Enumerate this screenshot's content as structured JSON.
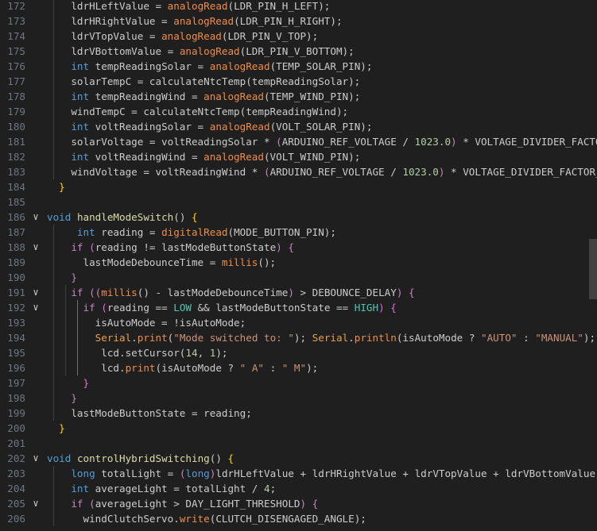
{
  "editor": {
    "lines": [
      {
        "num": "172",
        "fold": "",
        "tokens": [
          [
            "t-var",
            "    ldrHLeftValue = "
          ],
          [
            "t-ard",
            "analogRead"
          ],
          [
            "t-var",
            "(LDR_PIN_H_LEFT);"
          ]
        ]
      },
      {
        "num": "173",
        "fold": "",
        "tokens": [
          [
            "t-var",
            "    ldrHRightValue = "
          ],
          [
            "t-ard",
            "analogRead"
          ],
          [
            "t-var",
            "(LDR_PIN_H_RIGHT);"
          ]
        ]
      },
      {
        "num": "174",
        "fold": "",
        "tokens": [
          [
            "t-var",
            "    ldrVTopValue = "
          ],
          [
            "t-ard",
            "analogRead"
          ],
          [
            "t-var",
            "(LDR_PIN_V_TOP);"
          ]
        ]
      },
      {
        "num": "175",
        "fold": "",
        "tokens": [
          [
            "t-var",
            "    ldrVBottomValue = "
          ],
          [
            "t-ard",
            "analogRead"
          ],
          [
            "t-var",
            "(LDR_PIN_V_BOTTOM);"
          ]
        ]
      },
      {
        "num": "176",
        "fold": "",
        "tokens": [
          [
            "t-kw",
            "    int"
          ],
          [
            "t-var",
            " tempReadingSolar = "
          ],
          [
            "t-ard",
            "analogRead"
          ],
          [
            "t-var",
            "(TEMP_SOLAR_PIN);"
          ]
        ]
      },
      {
        "num": "177",
        "fold": "",
        "tokens": [
          [
            "t-var",
            "    solarTempC = calculateNtcTemp(tempReadingSolar);"
          ]
        ]
      },
      {
        "num": "178",
        "fold": "",
        "tokens": [
          [
            "t-kw",
            "    int"
          ],
          [
            "t-var",
            " tempReadingWind = "
          ],
          [
            "t-ard",
            "analogRead"
          ],
          [
            "t-var",
            "(TEMP_WIND_PIN);"
          ]
        ]
      },
      {
        "num": "179",
        "fold": "",
        "tokens": [
          [
            "t-var",
            "    windTempC = calculateNtcTemp(tempReadingWind);"
          ]
        ]
      },
      {
        "num": "180",
        "fold": "",
        "tokens": [
          [
            "t-kw",
            "    int"
          ],
          [
            "t-var",
            " voltReadingSolar = "
          ],
          [
            "t-ard",
            "analogRead"
          ],
          [
            "t-var",
            "(VOLT_SOLAR_PIN);"
          ]
        ]
      },
      {
        "num": "181",
        "fold": "",
        "tokens": [
          [
            "t-var",
            "    solarVoltage = voltReadingSolar * "
          ],
          [
            "t-paren1",
            "("
          ],
          [
            "t-var",
            "ARDUINO_REF_VOLTAGE / "
          ],
          [
            "t-num",
            "1023.0"
          ],
          [
            "t-paren1",
            ")"
          ],
          [
            "t-var",
            " * VOLTAGE_DIVIDER_FACTO"
          ]
        ]
      },
      {
        "num": "182",
        "fold": "",
        "tokens": [
          [
            "t-kw",
            "    int"
          ],
          [
            "t-var",
            " voltReadingWind = "
          ],
          [
            "t-ard",
            "analogRead"
          ],
          [
            "t-var",
            "(VOLT_WIND_PIN);"
          ]
        ]
      },
      {
        "num": "183",
        "fold": "",
        "tokens": [
          [
            "t-var",
            "    windVoltage = voltReadingWind * "
          ],
          [
            "t-paren1",
            "("
          ],
          [
            "t-var",
            "ARDUINO_REF_VOLTAGE / "
          ],
          [
            "t-num",
            "1023.0"
          ],
          [
            "t-paren1",
            ")"
          ],
          [
            "t-var",
            " * VOLTAGE_DIVIDER_FACTOR_"
          ]
        ]
      },
      {
        "num": "184",
        "fold": "",
        "tokens": [
          [
            "t-brace",
            "  }"
          ]
        ]
      },
      {
        "num": "185",
        "fold": "",
        "tokens": []
      },
      {
        "num": "186",
        "fold": "v",
        "tokens": [
          [
            "t-kw",
            "void"
          ],
          [
            "t-var",
            " "
          ],
          [
            "t-fn",
            "handleModeSwitch"
          ],
          [
            "t-var",
            "() "
          ],
          [
            "t-brace",
            "{"
          ]
        ]
      },
      {
        "num": "187",
        "fold": "",
        "tokens": [
          [
            "t-kw",
            "     int"
          ],
          [
            "t-var",
            " reading = "
          ],
          [
            "t-ard",
            "digitalRead"
          ],
          [
            "t-var",
            "(MODE_BUTTON_PIN);"
          ]
        ]
      },
      {
        "num": "188",
        "fold": "v",
        "tokens": [
          [
            "t-ctl",
            "    if"
          ],
          [
            "t-var",
            " "
          ],
          [
            "t-paren1",
            "("
          ],
          [
            "t-var",
            "reading != lastModeButtonState"
          ],
          [
            "t-paren1",
            ")"
          ],
          [
            "t-var",
            " "
          ],
          [
            "t-paren1",
            "{"
          ]
        ]
      },
      {
        "num": "189",
        "fold": "",
        "tokens": [
          [
            "t-var",
            "      lastModeDebounceTime = "
          ],
          [
            "t-ard",
            "millis"
          ],
          [
            "t-var",
            "();"
          ]
        ]
      },
      {
        "num": "190",
        "fold": "",
        "tokens": [
          [
            "t-paren1",
            "    }"
          ]
        ]
      },
      {
        "num": "191",
        "fold": "v",
        "tokens": [
          [
            "t-ctl",
            "    if"
          ],
          [
            "t-var",
            " "
          ],
          [
            "t-paren1",
            "(("
          ],
          [
            "t-ard",
            "millis"
          ],
          [
            "t-var",
            "() - lastModeDebounceTime"
          ],
          [
            "t-paren1",
            ")"
          ],
          [
            "t-var",
            " > DEBOUNCE_DELAY"
          ],
          [
            "t-paren1",
            ")"
          ],
          [
            "t-var",
            " "
          ],
          [
            "t-paren1",
            "{"
          ]
        ]
      },
      {
        "num": "192",
        "fold": "v",
        "tokens": [
          [
            "t-ctl",
            "      if"
          ],
          [
            "t-var",
            " "
          ],
          [
            "t-paren2",
            "("
          ],
          [
            "t-var",
            "reading == "
          ],
          [
            "t-lowhigh",
            "LOW"
          ],
          [
            "t-var",
            " && lastModeButtonState == "
          ],
          [
            "t-lowhigh",
            "HIGH"
          ],
          [
            "t-paren2",
            ")"
          ],
          [
            "t-var",
            " "
          ],
          [
            "t-paren2",
            "{"
          ]
        ]
      },
      {
        "num": "193",
        "fold": "",
        "tokens": [
          [
            "t-var",
            "        isAutoMode = !isAutoMode;"
          ]
        ]
      },
      {
        "num": "194",
        "fold": "",
        "tokens": [
          [
            "t-api",
            "        Serial"
          ],
          [
            "t-var",
            "."
          ],
          [
            "t-ard",
            "print"
          ],
          [
            "t-var",
            "("
          ],
          [
            "t-str",
            "\"Mode switched to: \""
          ],
          [
            "t-var",
            "); "
          ],
          [
            "t-api",
            "Serial"
          ],
          [
            "t-var",
            "."
          ],
          [
            "t-ard",
            "println"
          ],
          [
            "t-var",
            "(isAutoMode ? "
          ],
          [
            "t-str",
            "\"AUTO\""
          ],
          [
            "t-var",
            " : "
          ],
          [
            "t-str",
            "\"MANUAL\""
          ],
          [
            "t-var",
            ");"
          ]
        ]
      },
      {
        "num": "195",
        "fold": "",
        "tokens": [
          [
            "t-var",
            "         lcd.setCursor("
          ],
          [
            "t-num",
            "14"
          ],
          [
            "t-var",
            ", "
          ],
          [
            "t-num",
            "1"
          ],
          [
            "t-var",
            ");"
          ]
        ]
      },
      {
        "num": "196",
        "fold": "",
        "tokens": [
          [
            "t-var",
            "         lcd."
          ],
          [
            "t-ard",
            "print"
          ],
          [
            "t-var",
            "(isAutoMode ? "
          ],
          [
            "t-str",
            "\" A\""
          ],
          [
            "t-var",
            " : "
          ],
          [
            "t-str",
            "\" M\""
          ],
          [
            "t-var",
            ");"
          ]
        ]
      },
      {
        "num": "197",
        "fold": "",
        "tokens": [
          [
            "t-paren2",
            "      }"
          ]
        ]
      },
      {
        "num": "198",
        "fold": "",
        "tokens": [
          [
            "t-paren1",
            "    }"
          ]
        ]
      },
      {
        "num": "199",
        "fold": "",
        "tokens": [
          [
            "t-var",
            "    lastModeButtonState = reading;"
          ]
        ]
      },
      {
        "num": "200",
        "fold": "",
        "tokens": [
          [
            "t-brace",
            "  }"
          ]
        ]
      },
      {
        "num": "201",
        "fold": "",
        "tokens": []
      },
      {
        "num": "202",
        "fold": "v",
        "tokens": [
          [
            "t-kw",
            "void"
          ],
          [
            "t-var",
            " "
          ],
          [
            "t-fn",
            "controlHybridSwitching"
          ],
          [
            "t-var",
            "() "
          ],
          [
            "t-brace",
            "{"
          ]
        ]
      },
      {
        "num": "203",
        "fold": "",
        "tokens": [
          [
            "t-kw",
            "    long"
          ],
          [
            "t-var",
            " totalLight = "
          ],
          [
            "t-paren1",
            "("
          ],
          [
            "t-kw",
            "long"
          ],
          [
            "t-paren1",
            ")"
          ],
          [
            "t-var",
            "ldrHLeftValue + ldrHRightValue + ldrVTopValue + ldrVBottomValue;"
          ]
        ]
      },
      {
        "num": "204",
        "fold": "",
        "tokens": [
          [
            "t-kw",
            "    int"
          ],
          [
            "t-var",
            " averageLight = totalLight / "
          ],
          [
            "t-num",
            "4"
          ],
          [
            "t-var",
            ";"
          ]
        ]
      },
      {
        "num": "205",
        "fold": "v",
        "tokens": [
          [
            "t-ctl",
            "    if"
          ],
          [
            "t-var",
            " "
          ],
          [
            "t-paren1",
            "("
          ],
          [
            "t-var",
            "averageLight > DAY_LIGHT_THRESHOLD"
          ],
          [
            "t-paren1",
            ")"
          ],
          [
            "t-var",
            " "
          ],
          [
            "t-paren1",
            "{"
          ]
        ]
      },
      {
        "num": "206",
        "fold": "",
        "tokens": [
          [
            "t-var",
            "      windClutchServo."
          ],
          [
            "t-ard",
            "write"
          ],
          [
            "t-var",
            "(CLUTCH_DISENGAGED_ANGLE);"
          ]
        ]
      }
    ]
  }
}
